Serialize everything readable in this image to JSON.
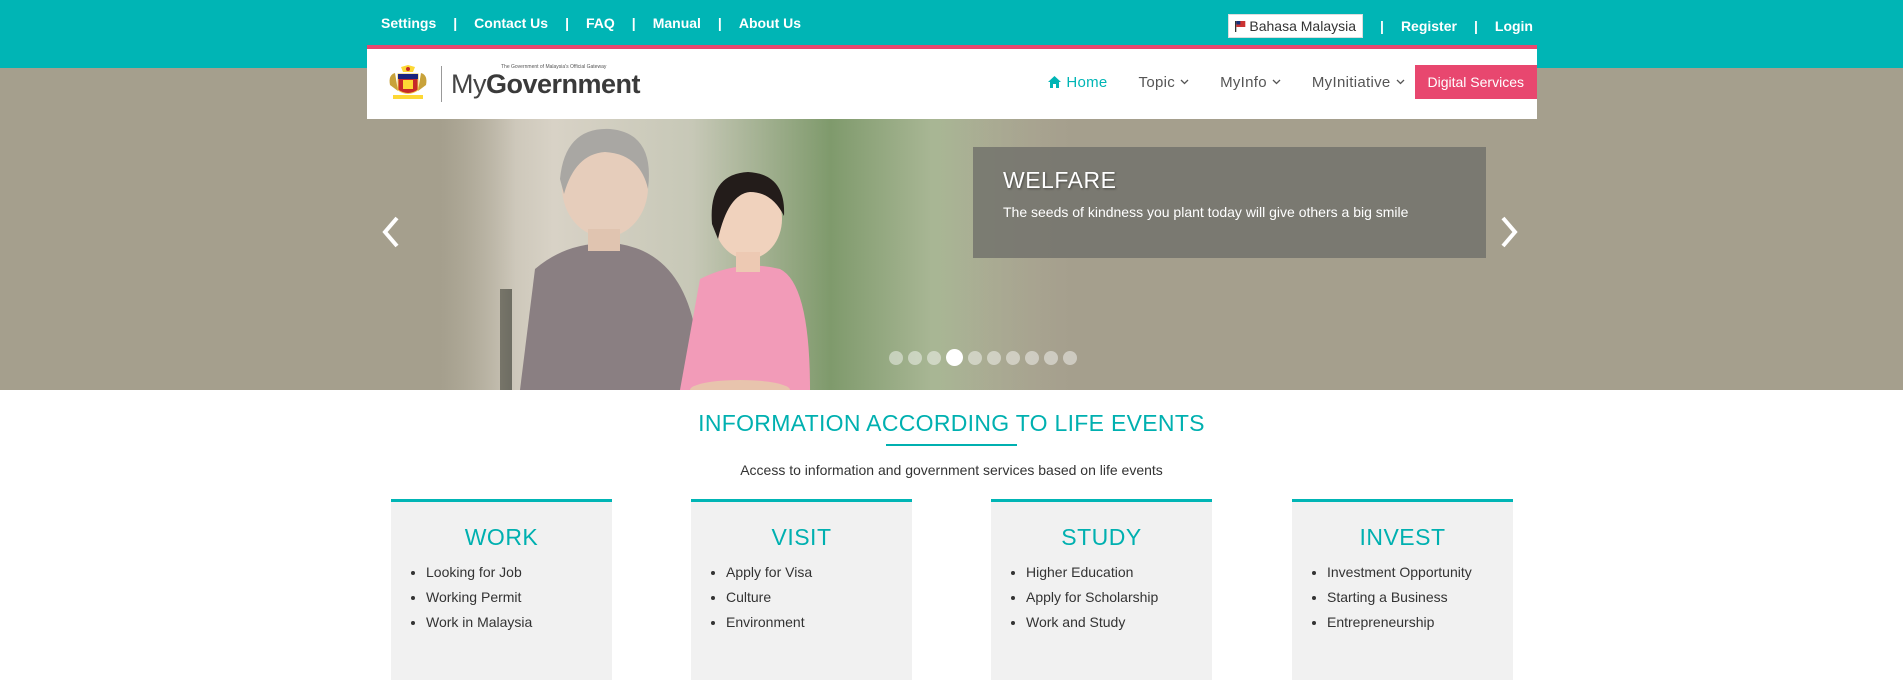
{
  "topbar": {
    "links": [
      "Settings",
      "Contact Us",
      "FAQ",
      "Manual",
      "About Us"
    ],
    "language_label": "Bahasa Malaysia",
    "register_label": "Register",
    "login_label": "Login",
    "color": "#00b5b5"
  },
  "logo": {
    "tagline": "The Government of Malaysia's Official Gateway",
    "name_prefix": "My",
    "name_main": "Government"
  },
  "nav": {
    "home_label": "Home",
    "items": [
      "Topic",
      "MyInfo",
      "MyInitiative"
    ],
    "digital_services_label": "Digital Services",
    "accent": "#e8476f"
  },
  "hero": {
    "title": "WELFARE",
    "caption": "The seeds of kindness you plant today will give others a big smile",
    "slide_count": 10,
    "active_slide": 4
  },
  "life_events": {
    "title": "INFORMATION ACCORDING TO LIFE EVENTS",
    "subtitle": "Access to information and government services based on life events",
    "cards": [
      {
        "title": "WORK",
        "items": [
          "Looking for Job",
          "Working Permit",
          "Work in Malaysia"
        ]
      },
      {
        "title": "VISIT",
        "items": [
          "Apply for Visa",
          "Culture",
          "Environment"
        ]
      },
      {
        "title": "STUDY",
        "items": [
          "Higher Education",
          "Apply for Scholarship",
          "Work and Study"
        ]
      },
      {
        "title": "INVEST",
        "items": [
          "Investment Opportunity",
          "Starting a Business",
          "Entrepreneurship"
        ]
      }
    ]
  }
}
